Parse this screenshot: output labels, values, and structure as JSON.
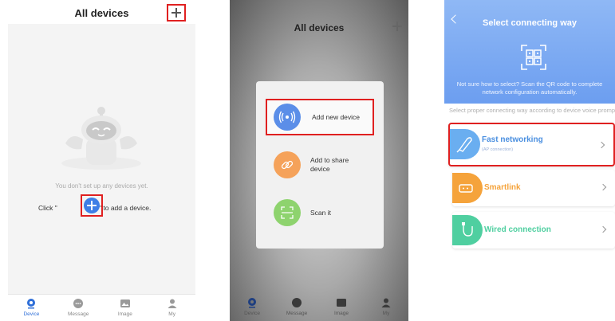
{
  "panel1": {
    "title": "All devices",
    "empty_message": "You don't set up any devices yet.",
    "click_prefix": "Click \"",
    "click_suffix": "\" to add a device.",
    "tabs": [
      {
        "label": "Device",
        "icon": "device-icon"
      },
      {
        "label": "Message",
        "icon": "message-icon"
      },
      {
        "label": "Image",
        "icon": "image-icon"
      },
      {
        "label": "My",
        "icon": "person-icon"
      }
    ]
  },
  "panel2": {
    "title": "All devices",
    "menu": [
      {
        "label": "Add new device",
        "icon": "wifi-signal-icon",
        "color": "#5b8ee8"
      },
      {
        "label": "Add to share device",
        "icon": "link-icon",
        "color": "#f5a25a"
      },
      {
        "label": "Scan it",
        "icon": "scan-icon",
        "color": "#8ed36e"
      }
    ],
    "tabs": [
      {
        "label": "Device"
      },
      {
        "label": "Message"
      },
      {
        "label": "Image"
      },
      {
        "label": "My"
      }
    ]
  },
  "panel3": {
    "title": "Select connecting way",
    "banner_text": "Not sure how to select? Scan the QR code to complete network configuration automatically.",
    "sub_text": "Select proper connecting way according to device voice prompts or instructions",
    "options": [
      {
        "title": "Fast networking",
        "subtitle": "(AP connection)",
        "color": "#6aaef0",
        "title_color": "#4a8fe0",
        "icon": "rocket-icon"
      },
      {
        "title": "Smartlink",
        "subtitle": "",
        "color": "#f5a33b",
        "title_color": "#f5a33b",
        "icon": "router-icon"
      },
      {
        "title": "Wired connection",
        "subtitle": "",
        "color": "#4fcfa0",
        "title_color": "#4fcfa0",
        "icon": "cable-icon"
      }
    ]
  },
  "colors": {
    "highlight": "#e02020",
    "accent_blue": "#3e7ee6"
  }
}
